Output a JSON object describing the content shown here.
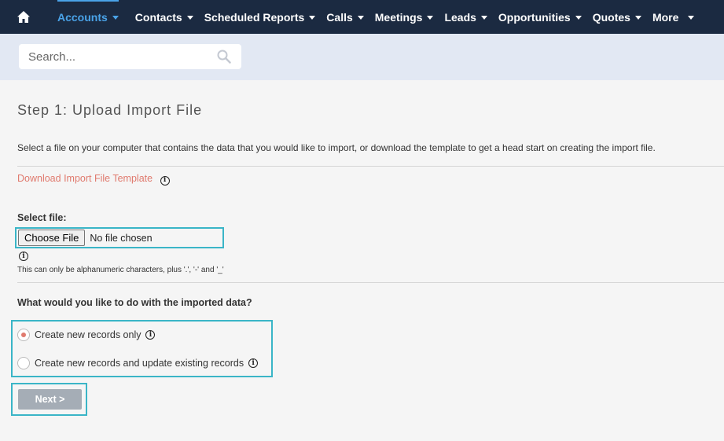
{
  "nav": {
    "items": [
      {
        "label": "Accounts",
        "active": true
      },
      {
        "label": "Contacts"
      },
      {
        "label": "Scheduled Reports"
      },
      {
        "label": "Calls"
      },
      {
        "label": "Meetings"
      },
      {
        "label": "Leads"
      },
      {
        "label": "Opportunities"
      },
      {
        "label": "Quotes"
      },
      {
        "label": "More"
      }
    ],
    "home_icon": "home-icon",
    "active_color": "#4aa3e8",
    "bg_color": "#1b2a41"
  },
  "search": {
    "placeholder": "Search...",
    "icon": "search-icon"
  },
  "page": {
    "title": "Step 1: Upload Import File",
    "description": "Select a file on your computer that contains the data that you would like to import, or download the template to get a head start on creating the import file.",
    "download_link": "Download Import File Template",
    "select_file_label": "Select file:",
    "choose_file_button": "Choose File",
    "no_file_text": "No file chosen",
    "file_note": "This can only be alphanumeric characters, plus '.', '-' and '_'",
    "question": "What would you like to do with the imported data?",
    "options": [
      {
        "label": "Create new records only",
        "selected": true
      },
      {
        "label": "Create new records and update existing records",
        "selected": false
      }
    ],
    "next_button": "Next >",
    "link_color": "#e07a6e",
    "highlight_color": "#3ab5c7"
  }
}
